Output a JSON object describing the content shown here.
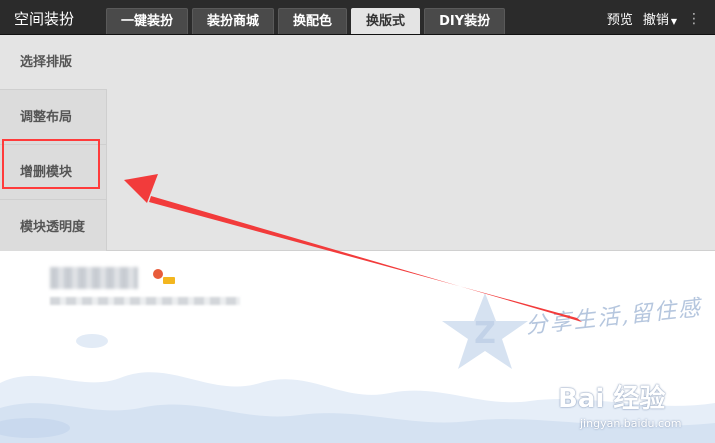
{
  "app_title": "空间装扮",
  "tabs": [
    {
      "label": "一键装扮"
    },
    {
      "label": "装扮商城"
    },
    {
      "label": "换配色"
    },
    {
      "label": "换版式",
      "active": true
    },
    {
      "label": "DIY装扮"
    }
  ],
  "actions": {
    "preview": "预览",
    "undo": "撤销"
  },
  "sidebar": {
    "items": [
      {
        "label": "选择排版"
      },
      {
        "label": "调整布局"
      },
      {
        "label": "增删模块",
        "highlighted": true
      },
      {
        "label": "模块透明度"
      }
    ]
  },
  "preview": {
    "handwriting": "分享生活,留住感"
  },
  "watermark": {
    "brand": "Bai 经验",
    "url": "jingyan.baidu.com"
  },
  "colors": {
    "topbar": "#2b2b2b",
    "panel": "#e4e4e4",
    "highlight": "#ff3b3b",
    "arrow": "#f23b3b"
  }
}
